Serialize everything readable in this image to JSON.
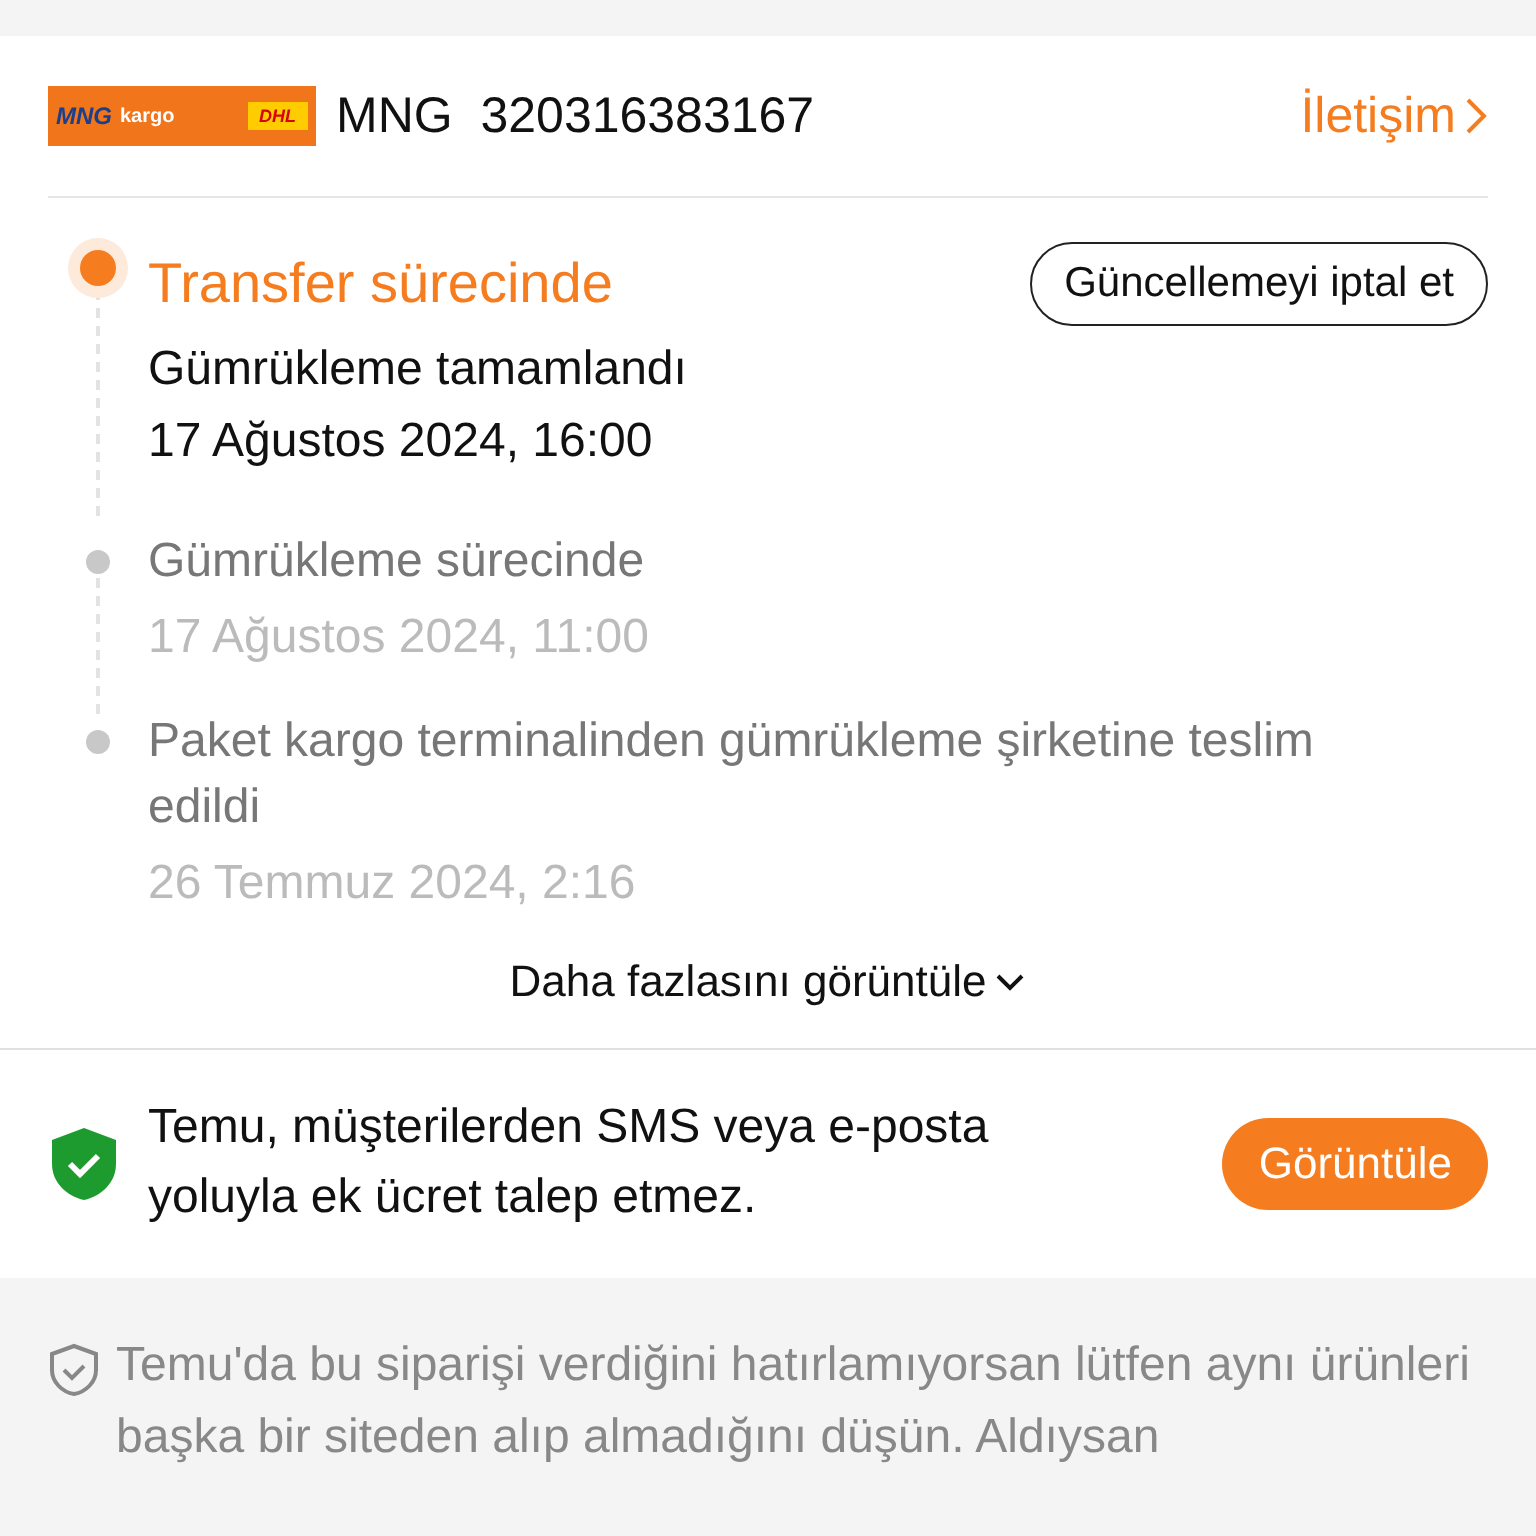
{
  "shipment": {
    "logo": {
      "left": "MNG",
      "left_small": "kargo",
      "right": "DHL"
    },
    "carrier": "MNG",
    "tracking_number": "320316383167",
    "contact_link": "İletişim"
  },
  "events": [
    {
      "title": "Transfer sürecinde",
      "detail": "Gümrükleme tamamlandı",
      "time": "17 Ağustos 2024, 16:00",
      "current": true,
      "action": "Güncellemeyi iptal et"
    },
    {
      "title": "Gümrükleme sürecinde",
      "time": "17 Ağustos 2024, 11:00",
      "current": false
    },
    {
      "title": "Paket kargo terminalinden gümrükleme şirketine teslim edildi",
      "time": "26 Temmuz 2024, 2:16",
      "current": false
    }
  ],
  "more_link": "Daha fazlasını görüntüle",
  "notice": {
    "text": "Temu, müşterilerden SMS veya e-posta yoluyla ek ücret talep etmez.",
    "button": "Görüntüle"
  },
  "footer_note": "Temu'da bu siparişi verdiğini hatırlamıyorsan lütfen aynı ürünleri başka bir siteden alıp almadığını düşün. Aldıysan"
}
